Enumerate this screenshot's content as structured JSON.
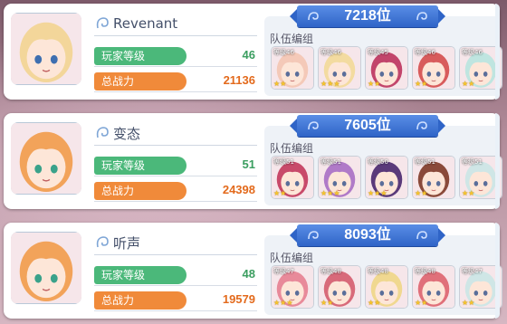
{
  "labels": {
    "player_level": "玩家等级",
    "total_power": "总战力",
    "team": "队伍编组",
    "member_level_prefix": "等级"
  },
  "colors": {
    "level_green": "#4bb87a",
    "power_orange": "#f08a3a",
    "rank_blue": "#2f64c7"
  },
  "entries": [
    {
      "name": "Revenant",
      "rank": "7218位",
      "level": "46",
      "power": "21136",
      "portrait": {
        "hair": "#f3d69a",
        "eye": "#3e6fb0"
      },
      "members": [
        {
          "level": "46",
          "stars": "★★",
          "hair": "#f4c9b8"
        },
        {
          "level": "46",
          "stars": "★★★",
          "hair": "#f3dba0"
        },
        {
          "level": "45",
          "stars": "★★",
          "hair": "#c2456b"
        },
        {
          "level": "46",
          "stars": "★★",
          "hair": "#d85c5c"
        },
        {
          "level": "46",
          "stars": "★★",
          "hair": "#bfe5e0"
        }
      ]
    },
    {
      "name": "变态",
      "rank": "7605位",
      "level": "51",
      "power": "24398",
      "portrait": {
        "hair": "#f2a35a",
        "eye": "#3aa28a"
      },
      "members": [
        {
          "level": "51",
          "stars": "★★",
          "hair": "#c84a6a"
        },
        {
          "level": "51",
          "stars": "★★★",
          "hair": "#b07ac8"
        },
        {
          "level": "50",
          "stars": "★★★",
          "hair": "#5a3a7a"
        },
        {
          "level": "51",
          "stars": "★★",
          "hair": "#8a4a3a"
        },
        {
          "level": "51",
          "stars": "★★",
          "hair": "#cfe6e6"
        }
      ]
    },
    {
      "name": "听声",
      "rank": "8093位",
      "level": "48",
      "power": "19579",
      "portrait": {
        "hair": "#f2a35a",
        "eye": "#3aa28a"
      },
      "members": [
        {
          "level": "47",
          "stars": "★★★",
          "hair": "#e88a9a"
        },
        {
          "level": "48",
          "stars": "★★",
          "hair": "#d86a7a"
        },
        {
          "level": "48",
          "stars": "★★",
          "hair": "#f0d890"
        },
        {
          "level": "48",
          "stars": "★★",
          "hair": "#e0707a"
        },
        {
          "level": "47",
          "stars": "★★",
          "hair": "#cfe6e6"
        }
      ]
    }
  ]
}
